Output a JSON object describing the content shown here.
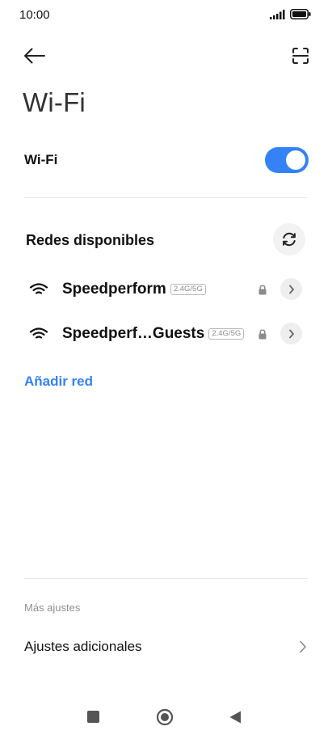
{
  "status_bar": {
    "time": "10:00",
    "signal_icon": "signal-bars-icon",
    "battery_icon": "battery-full-icon"
  },
  "header": {
    "back_icon": "arrow-left-icon",
    "scan_icon": "qr-scan-icon",
    "title": "Wi-Fi"
  },
  "wifi_toggle": {
    "label": "Wi-Fi",
    "enabled": true,
    "accent": "#3482f6"
  },
  "networks": {
    "section_title": "Redes disponibles",
    "refresh_icon": "refresh-icon",
    "items": [
      {
        "name": "Speedperform",
        "band": "2.4G/5G",
        "secured": true
      },
      {
        "name": "Speedperf…Guests",
        "band": "2.4G/5G",
        "secured": true
      }
    ],
    "add_network_label": "Añadir red"
  },
  "more": {
    "section_label": "Más ajustes",
    "additional_settings_label": "Ajustes adicionales"
  },
  "nav_bar": {
    "recents_icon": "square-icon",
    "home_icon": "circle-home-icon",
    "back_icon": "triangle-back-icon"
  }
}
